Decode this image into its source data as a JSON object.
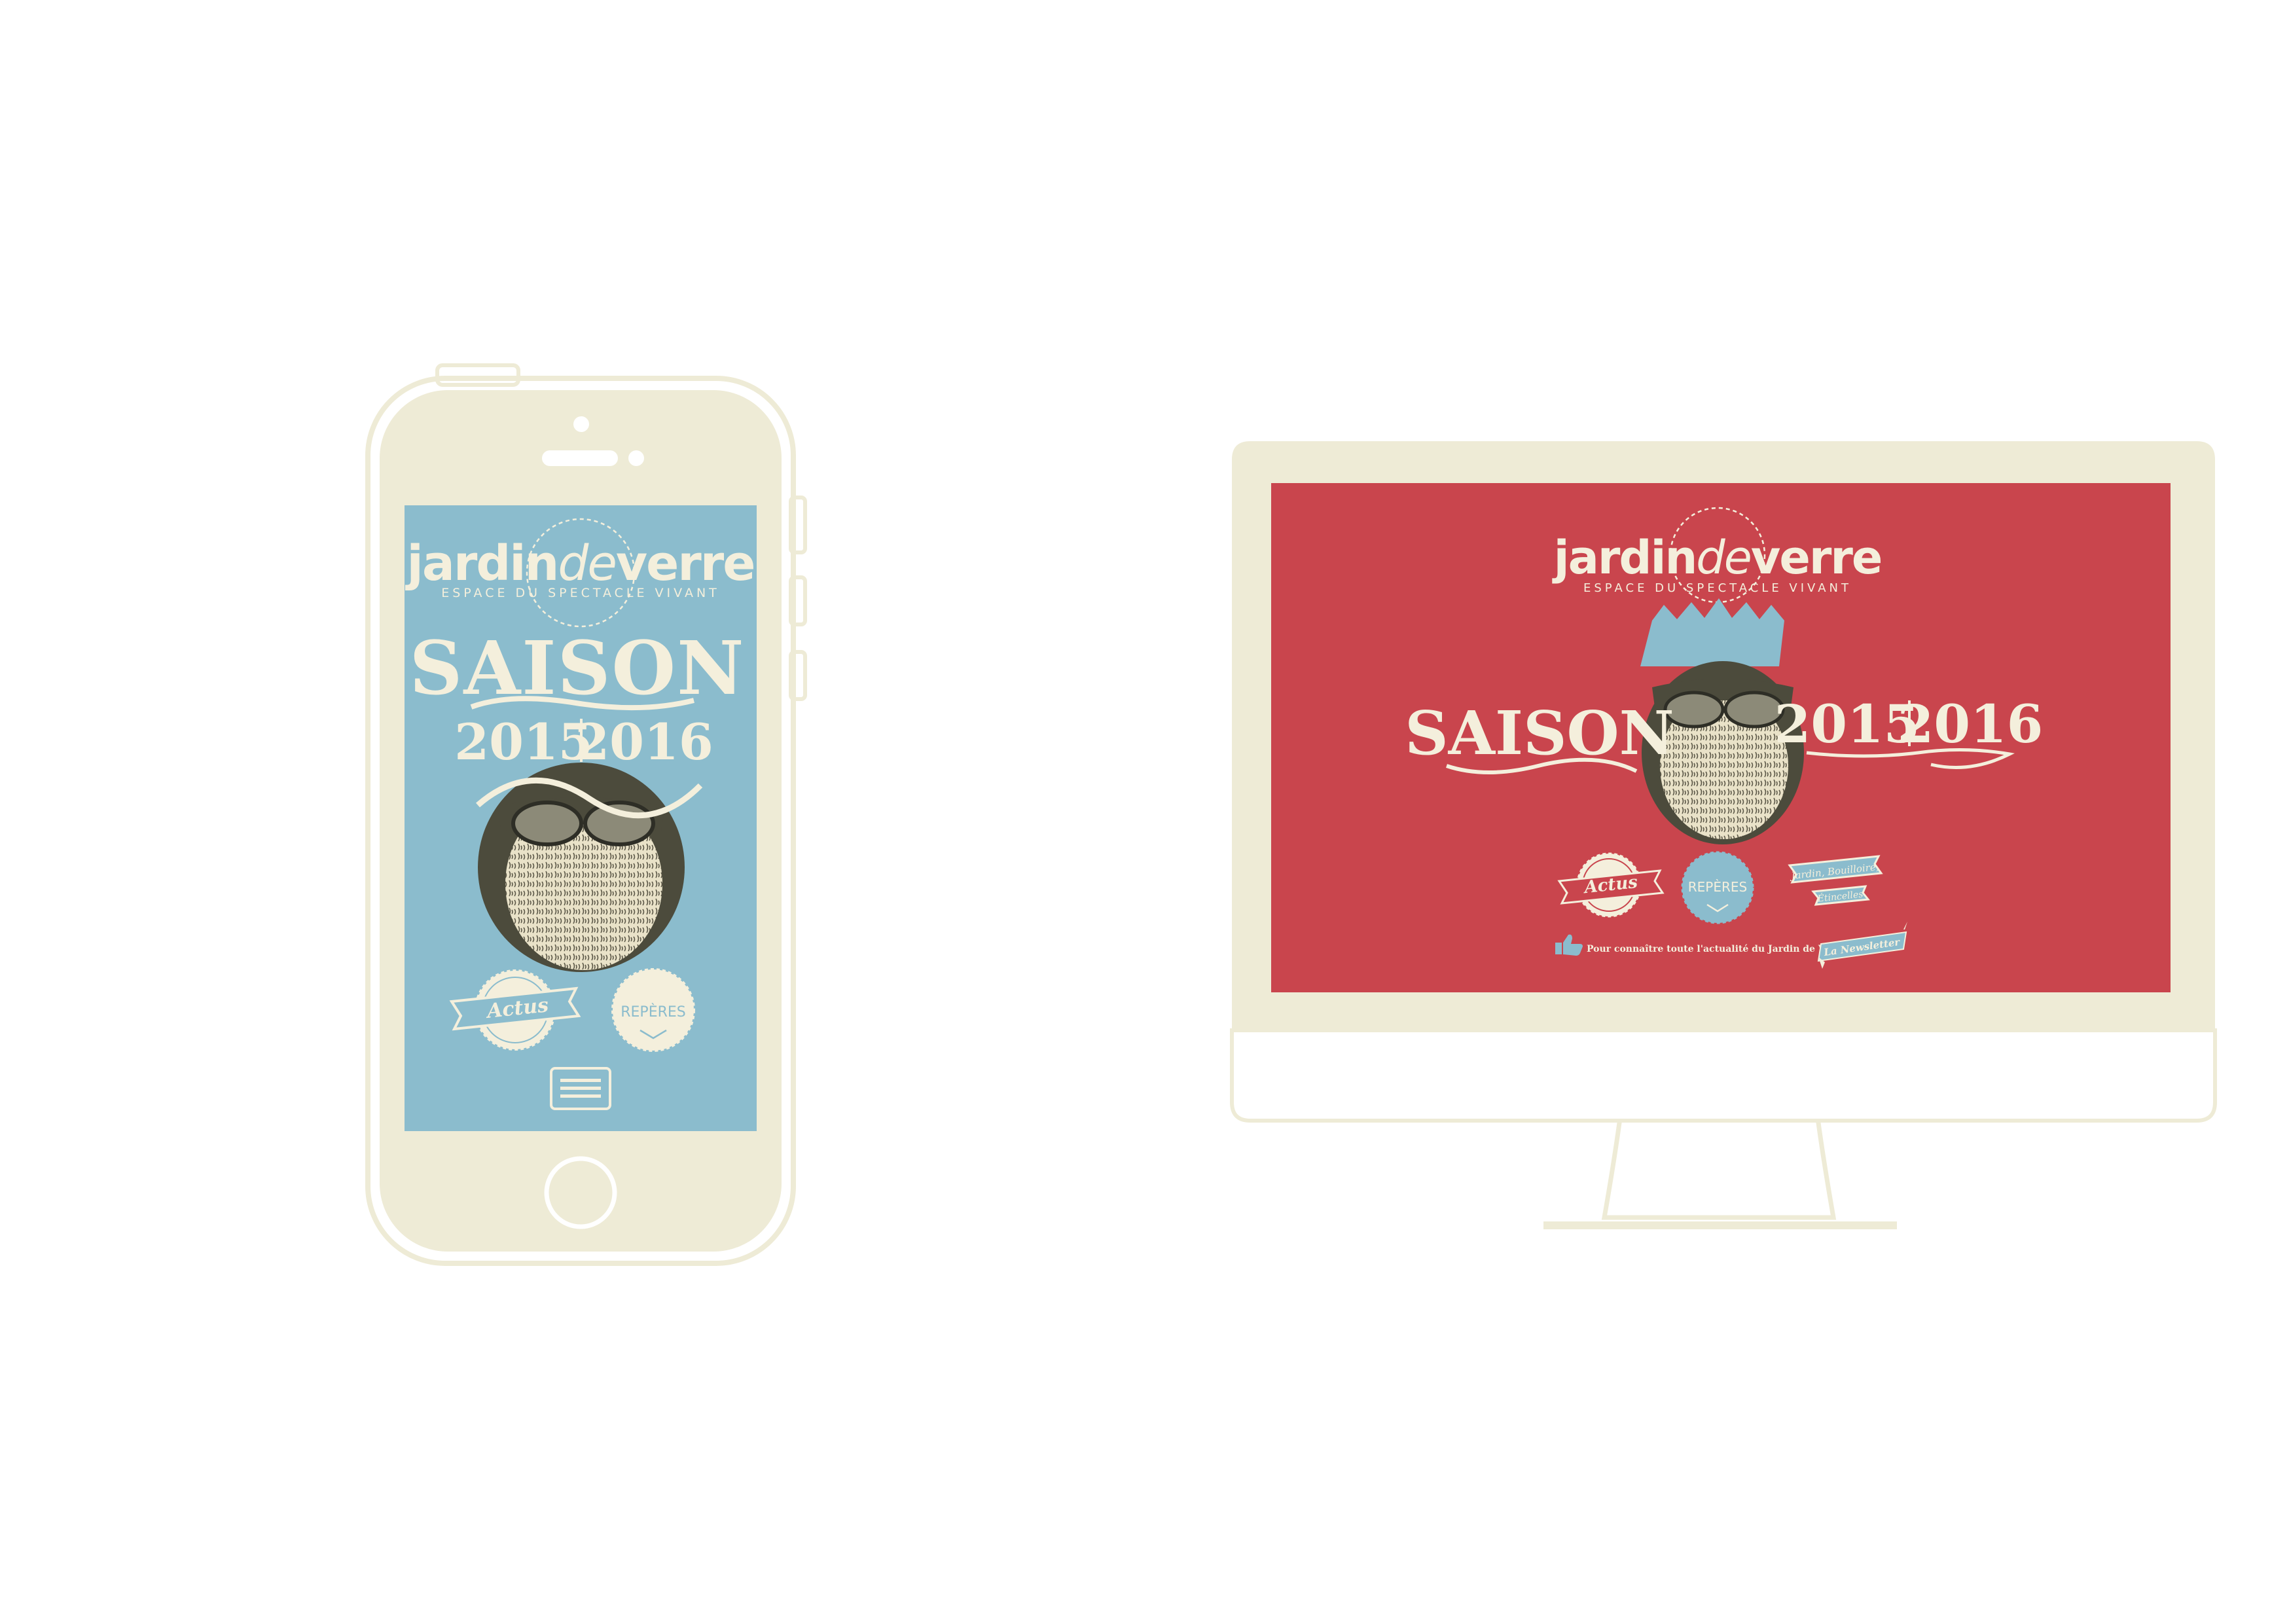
{
  "brand": {
    "name_part1": "jardin",
    "name_part2": "de",
    "name_part3": "verre",
    "tagline": "ESPACE DU SPECTACLE VIVANT"
  },
  "poster": {
    "saison": "SAISON",
    "year1": "2015",
    "year2": "2016"
  },
  "buttons": {
    "actus": "Actus",
    "reperes": "REPÈRES",
    "jardin_line1": "Jardin, Bouilloire,",
    "jardin_line2": "Étincelles"
  },
  "newsletter": {
    "text": "Pour connaître toute l'actualité du Jardin de Verre :",
    "label": "La Newsletter"
  },
  "colors": {
    "device_frame": "#eeebd6",
    "mobile_screen": "#8bbccd",
    "desktop_screen": "#c9454d",
    "cream": "#f4efdc",
    "ribbon_blue": "#7fbfd0",
    "dark_text": "#3a3a30"
  },
  "icons": {
    "menu": "hamburger-menu-icon",
    "thumb": "thumbs-up-icon",
    "chevron": "chevron-down-icon"
  }
}
